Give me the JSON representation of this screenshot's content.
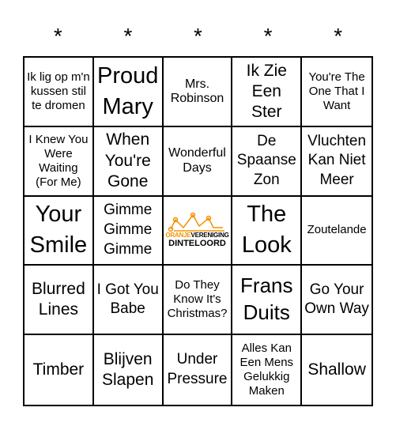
{
  "header": {
    "marks": [
      "*",
      "*",
      "*",
      "*",
      "*"
    ]
  },
  "free_space": {
    "logo_line1a": "ORANJE",
    "logo_line1b": "VERENIGING",
    "logo_line2": "DINTELOORD",
    "brand_color": "#f39200"
  },
  "cells": [
    "Ik lig op m'n kussen stil te dromen",
    "Proud Mary",
    "Mrs. Robinson",
    "Ik Zie Een Ster",
    "You're The One That I Want",
    "I Knew You Were Waiting (For Me)",
    "When You're Gone",
    "Wonderful Days",
    "De Spaanse Zon",
    "Vluchten Kan Niet Meer",
    "Your Smile",
    "Gimme Gimme Gimme",
    "",
    "The Look",
    "Zoutelande",
    "Blurred Lines",
    "I Got You Babe",
    "Do They Know It's Christmas?",
    "Frans Duits",
    "Go Your Own Way",
    "Timber",
    "Blijven Slapen",
    "Under Pressure",
    "Alles Kan Een Mens Gelukkig Maken",
    "Shallow"
  ]
}
